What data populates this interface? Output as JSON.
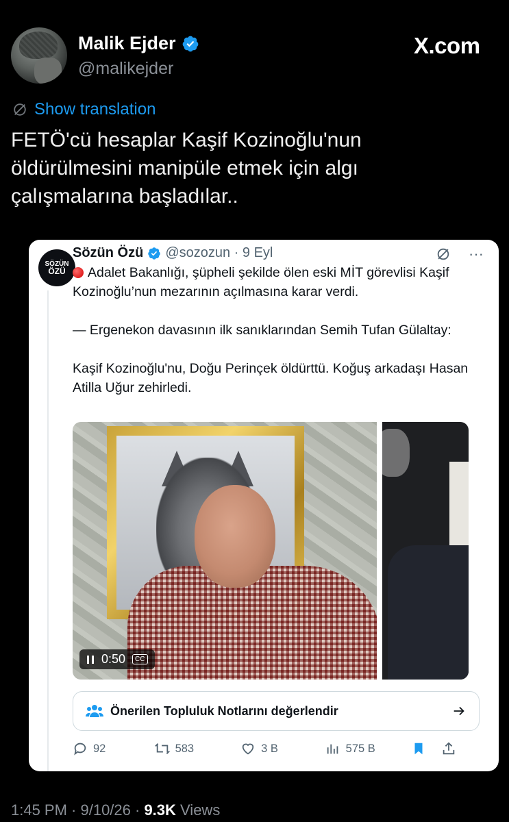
{
  "author": {
    "name": "Malik Ejder",
    "handle": "@malikejder",
    "site": "X.com"
  },
  "translation_link": "Show translation",
  "tweet_text": "FETÖ'cü hesaplar Kaşif Kozinoğlu'nun\nöldürülmesini manipüle etmek için algı\nçalışmalarına başladılar..",
  "quoted": {
    "avatar_lines": [
      "SÖZÜN",
      "ÖZÜ"
    ],
    "name": "Sözün Özü",
    "handle_time": "@sozozun · 9 Eyl",
    "more": "···",
    "para1": "Adalet Bakanlığı, şüpheli şekilde ölen eski MİT görevlisi Kaşif Kozinoğlu’nun mezarının açılmasına karar verdi.",
    "para2": "— Ergenekon davasının ilk sanıklarından Semih Tufan Gülaltay:",
    "para3": "Kaşif Kozinoğlu'nu, Doğu Perinçek öldürttü. Koğuş arkadaşı Hasan Atilla Uğur zehirledi.",
    "video_time": "0:50",
    "video_cc": "CC",
    "community_notes": "Önerilen Topluluk Notlarını değerlendir",
    "actions": {
      "replies": "92",
      "reposts": "583",
      "likes": "3 B",
      "views": "575 B"
    }
  },
  "footer": {
    "time_date": "1:45 PM · 9/10/26 · ",
    "views_count": "9.3K",
    "views_label": " Views"
  },
  "colors": {
    "accent": "#1d9bf0",
    "bookmark": "#1d9bf0",
    "background": "#000000"
  }
}
